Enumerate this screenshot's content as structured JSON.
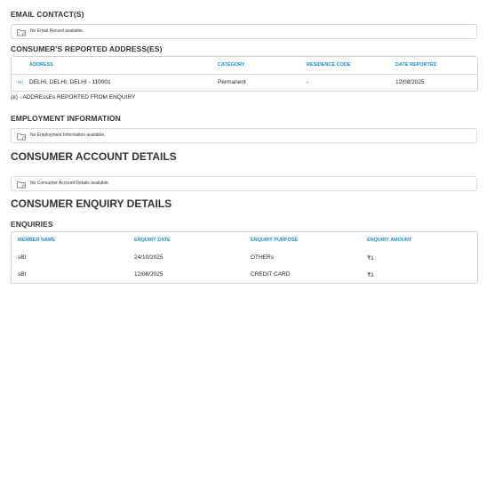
{
  "email": {
    "heading": "EMAIL CONTACT(S)",
    "empty_message": "No Email Record available."
  },
  "addresses": {
    "heading": "CONSUMER'S REPORTED ADDRESS(ES)",
    "columns": [
      "ADDRESS",
      "CATEGORY",
      "RESIDENCE CODE",
      "DATE REPORTED"
    ],
    "rows": [
      {
        "tag": "(e)",
        "address": "DELHI, DELHI, DELHI - 110001",
        "category": "Permanent",
        "residence_code": "-",
        "date_reported": "12/08/2025"
      }
    ],
    "footnote": "(e) - ADDREssEs REPORTED FROM ENQUIRY"
  },
  "employment": {
    "heading": "EMPLOYMENT INFORMATION",
    "empty_message": "No Employment Information available."
  },
  "accounts": {
    "heading": "CONSUMER ACCOUNT DETAILS",
    "empty_message": "No Consumer Account Details available."
  },
  "enquiry_details": {
    "heading": "CONSUMER ENQUIRY DETAILS"
  },
  "enquiries": {
    "heading": "ENQUIRIES",
    "columns": [
      "MEMBER NAME",
      "ENQUIRY DATE",
      "ENQUIRY PURPOSE",
      "ENQUIRY AMOUNT"
    ],
    "rows": [
      {
        "member": "sBI",
        "date": "24/10/2025",
        "purpose": "OTHERs",
        "amount": "₹1"
      },
      {
        "member": "sBI",
        "date": "12/08/2025",
        "purpose": "CREDIT CARD",
        "amount": "₹1"
      }
    ]
  },
  "icons": {
    "empty_state": "folder-icon"
  },
  "colors": {
    "header_text": "#1a8fd0",
    "border": "#d9d9d9"
  }
}
